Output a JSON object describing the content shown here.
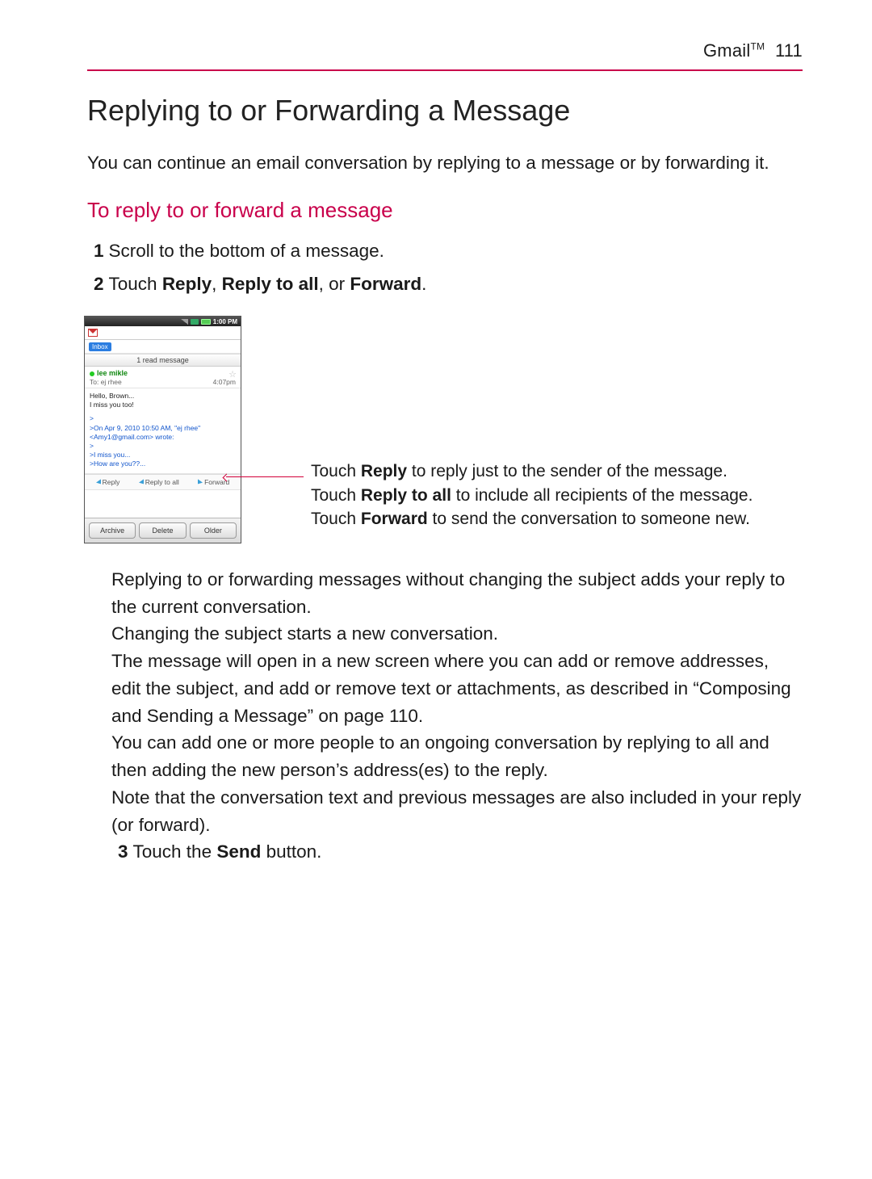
{
  "header": {
    "section": "Gmail",
    "tm": "TM",
    "page_number": "111"
  },
  "title": "Replying to or Forwarding a Message",
  "intro": "You can continue an email conversation by replying to a message or by forwarding it.",
  "subhead": "To reply to or forward a message",
  "steps": {
    "n1": "1",
    "s1": "Scroll to the bottom of a message.",
    "n2": "2",
    "s2a": "Touch ",
    "s2b": "Reply",
    "s2c": ", ",
    "s2d": "Reply to all",
    "s2e": ", or ",
    "s2f": "Forward",
    "s2g": ".",
    "n3": "3",
    "s3a": "Touch the ",
    "s3b": "Send",
    "s3c": " button."
  },
  "phone": {
    "status_time": "1:00 PM",
    "inbox_label": "Inbox",
    "read_banner": "1 read message",
    "sender": "lee mikle",
    "to_line": "To: ej rhee",
    "msg_time": "4:07pm",
    "body_line1": "Hello, Brown...",
    "body_line2": "I miss you too!",
    "quote_header": ">On Apr 9, 2010 10:50 AM, \"ej rhee\" <Amy1@gmail.com> wrote:",
    "quote_gt": ">",
    "quote_l1": ">I miss you...",
    "quote_l2": ">How are you??...",
    "reply": "Reply",
    "reply_all": "Reply to all",
    "forward": "Forward",
    "btn_archive": "Archive",
    "btn_delete": "Delete",
    "btn_older": "Older"
  },
  "callout": {
    "l1a": "Touch ",
    "l1b": "Reply",
    "l1c": " to reply just to the sender of the message.",
    "l2a": "Touch ",
    "l2b": "Reply to all",
    "l2c": " to include all recipients of the message.",
    "l3a": "Touch ",
    "l3b": "Forward",
    "l3c": " to send the conversation to someone new."
  },
  "body_paras": {
    "p1": "Replying to or forwarding messages without changing the subject adds your reply to the current conversation.",
    "p2": "Changing the subject starts a new conversation.",
    "p3": "The message will open in a new screen where you can add or remove addresses, edit the subject, and add or remove text or attachments, as described in “Composing and Sending a Message” on page 110.",
    "p4": "You can add one or more people to an ongoing conversation by replying to all and then adding the new person’s address(es) to the reply.",
    "p5": "Note that the conversation text and previous messages are also included in your reply (or forward)."
  }
}
